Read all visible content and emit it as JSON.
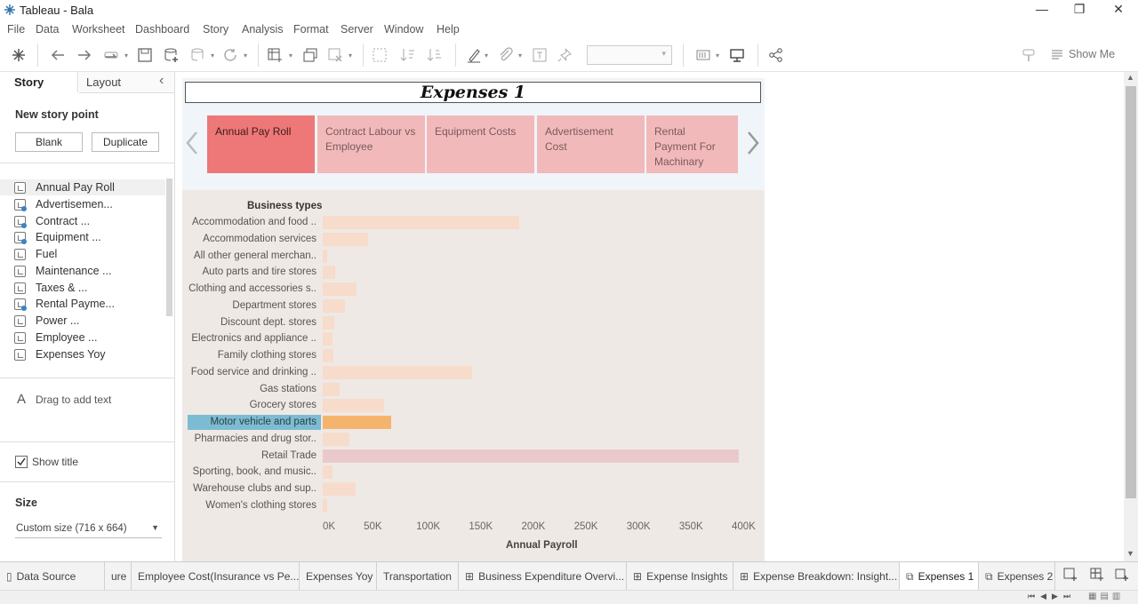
{
  "window": {
    "title": "Tableau - Bala",
    "controls": {
      "minimize": "—",
      "restore": "❐",
      "close": "✕"
    }
  },
  "menu": [
    "File",
    "Data",
    "Worksheet",
    "Dashboard",
    "Story",
    "Analysis",
    "Format",
    "Server",
    "Window",
    "Help"
  ],
  "toolbar": {
    "show_me_label": "Show Me",
    "icons": [
      "tableau-logo-icon",
      "undo-icon",
      "redo-icon",
      "swap-icon",
      "save-icon",
      "new-datasource-icon",
      "pause-icon",
      "refresh-icon",
      "new-worksheet-icon",
      "duplicate-icon",
      "clear-icon",
      "swap-rows-cols-icon",
      "sort-asc-icon",
      "sort-desc-icon",
      "highlight-icon",
      "group-icon",
      "label-icon",
      "pin-icon",
      "fit-icon",
      "presentation-icon",
      "share-icon",
      "bulb-icon"
    ]
  },
  "left_pane": {
    "tabs": {
      "story": "Story",
      "layout": "Layout"
    },
    "collapse_glyph": "‹",
    "new_story_point": "New story point",
    "blank_button": "Blank",
    "duplicate_button": "Duplicate",
    "items": [
      {
        "label": "Annual Pay Roll",
        "has_dot": false
      },
      {
        "label": "Advertisemen...",
        "has_dot": true
      },
      {
        "label": "Contract ...",
        "has_dot": true
      },
      {
        "label": "Equipment ...",
        "has_dot": true
      },
      {
        "label": "Fuel",
        "has_dot": false
      },
      {
        "label": "Maintenance ...",
        "has_dot": false
      },
      {
        "label": "Taxes & ...",
        "has_dot": false
      },
      {
        "label": "Rental Payme...",
        "has_dot": true
      },
      {
        "label": "Power ...",
        "has_dot": false
      },
      {
        "label": "Employee ...",
        "has_dot": false
      },
      {
        "label": "Expenses Yoy",
        "has_dot": false
      }
    ],
    "drag_text_glyph": "A",
    "drag_text": "Drag to add text",
    "show_title": "Show title",
    "size_header": "Size",
    "size_value": "Custom size (716 x 664)"
  },
  "story": {
    "title": "Expenses 1",
    "story_points": [
      {
        "label": "Annual Pay Roll",
        "active": true
      },
      {
        "label": "Contract Labour vs Employee",
        "active": false
      },
      {
        "label": "Equipment Costs",
        "active": false
      },
      {
        "label": "Advertisement Cost",
        "active": false
      },
      {
        "label": "Rental Payment For Machinary",
        "active": false
      }
    ]
  },
  "chart_data": {
    "type": "bar",
    "orientation": "horizontal",
    "row_header": "Business types",
    "xlabel": "Annual Payroll",
    "xlim": [
      0,
      400000
    ],
    "ticks": [
      "0K",
      "50K",
      "100K",
      "150K",
      "200K",
      "250K",
      "300K",
      "350K",
      "400K"
    ],
    "highlighted": "Motor vehicle and parts",
    "colors": {
      "default": "#f7dccb",
      "highlight_bar": "#f4b46e",
      "highlight_label": "#7cbcd2",
      "retail": "#eac9cc",
      "background": "#efe9e5"
    },
    "categories": [
      "Accommodation and food ..",
      "Accommodation services",
      "All other general merchan..",
      "Auto parts and tire stores",
      "Clothing and accessories s..",
      "Department stores",
      "Discount dept. stores",
      "Electronics and appliance ..",
      "Family clothing stores",
      "Food service and drinking ..",
      "Gas stations",
      "Grocery stores",
      "Motor vehicle and parts",
      "Pharmacies and drug stor..",
      "Retail Trade",
      "Sporting, book, and music..",
      "Warehouse clubs and sup..",
      "Women's clothing stores"
    ],
    "values": [
      187000,
      43000,
      4000,
      12000,
      32000,
      21000,
      11000,
      9000,
      10000,
      142000,
      16000,
      58000,
      65000,
      25000,
      396000,
      9000,
      31000,
      4000
    ]
  },
  "bottom_tabs": [
    {
      "label": "Data Source",
      "icon": "datasource-icon",
      "active": false
    },
    {
      "label": "ure",
      "icon": "",
      "active": false
    },
    {
      "label": "Employee Cost(Insurance vs Pe...",
      "icon": "",
      "active": false
    },
    {
      "label": "Expenses Yoy",
      "icon": "",
      "active": false
    },
    {
      "label": "Transportation",
      "icon": "",
      "active": false
    },
    {
      "label": "Business Expenditure Overvi...",
      "icon": "dashboard-icon",
      "active": false
    },
    {
      "label": "Expense Insights",
      "icon": "dashboard-icon",
      "active": false
    },
    {
      "label": "Expense Breakdown: Insight...",
      "icon": "dashboard-icon",
      "active": false
    },
    {
      "label": "Expenses 1",
      "icon": "story-icon",
      "active": true
    },
    {
      "label": "Expenses 2",
      "icon": "story-icon",
      "active": false
    }
  ]
}
